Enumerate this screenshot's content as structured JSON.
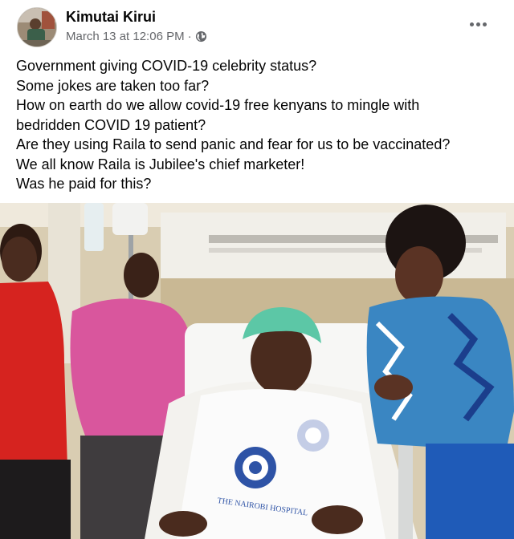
{
  "post": {
    "author": "Kimutai Kirui",
    "timestamp": "March 13 at 12:06 PM",
    "separator": "·",
    "privacy_icon": "globe-icon",
    "more_icon": "more-options-icon",
    "text_lines": [
      "Government giving COVID-19 celebrity status?",
      "Some jokes are taken too far?",
      "How on earth do we allow covid-19 free kenyans to mingle with",
      "bedridden COVID 19 patient?",
      "Are they using Raila to send panic and fear for us to be vaccinated?",
      "We all know Raila is Jubilee's chief marketer!",
      "Was he paid for this?"
    ]
  },
  "photo": {
    "description_icon": "hospital-photo",
    "gown_text": "THE NAIROBI HOSPITAL"
  },
  "colors": {
    "text": "#050505",
    "meta": "#65676b",
    "background": "#ffffff"
  }
}
